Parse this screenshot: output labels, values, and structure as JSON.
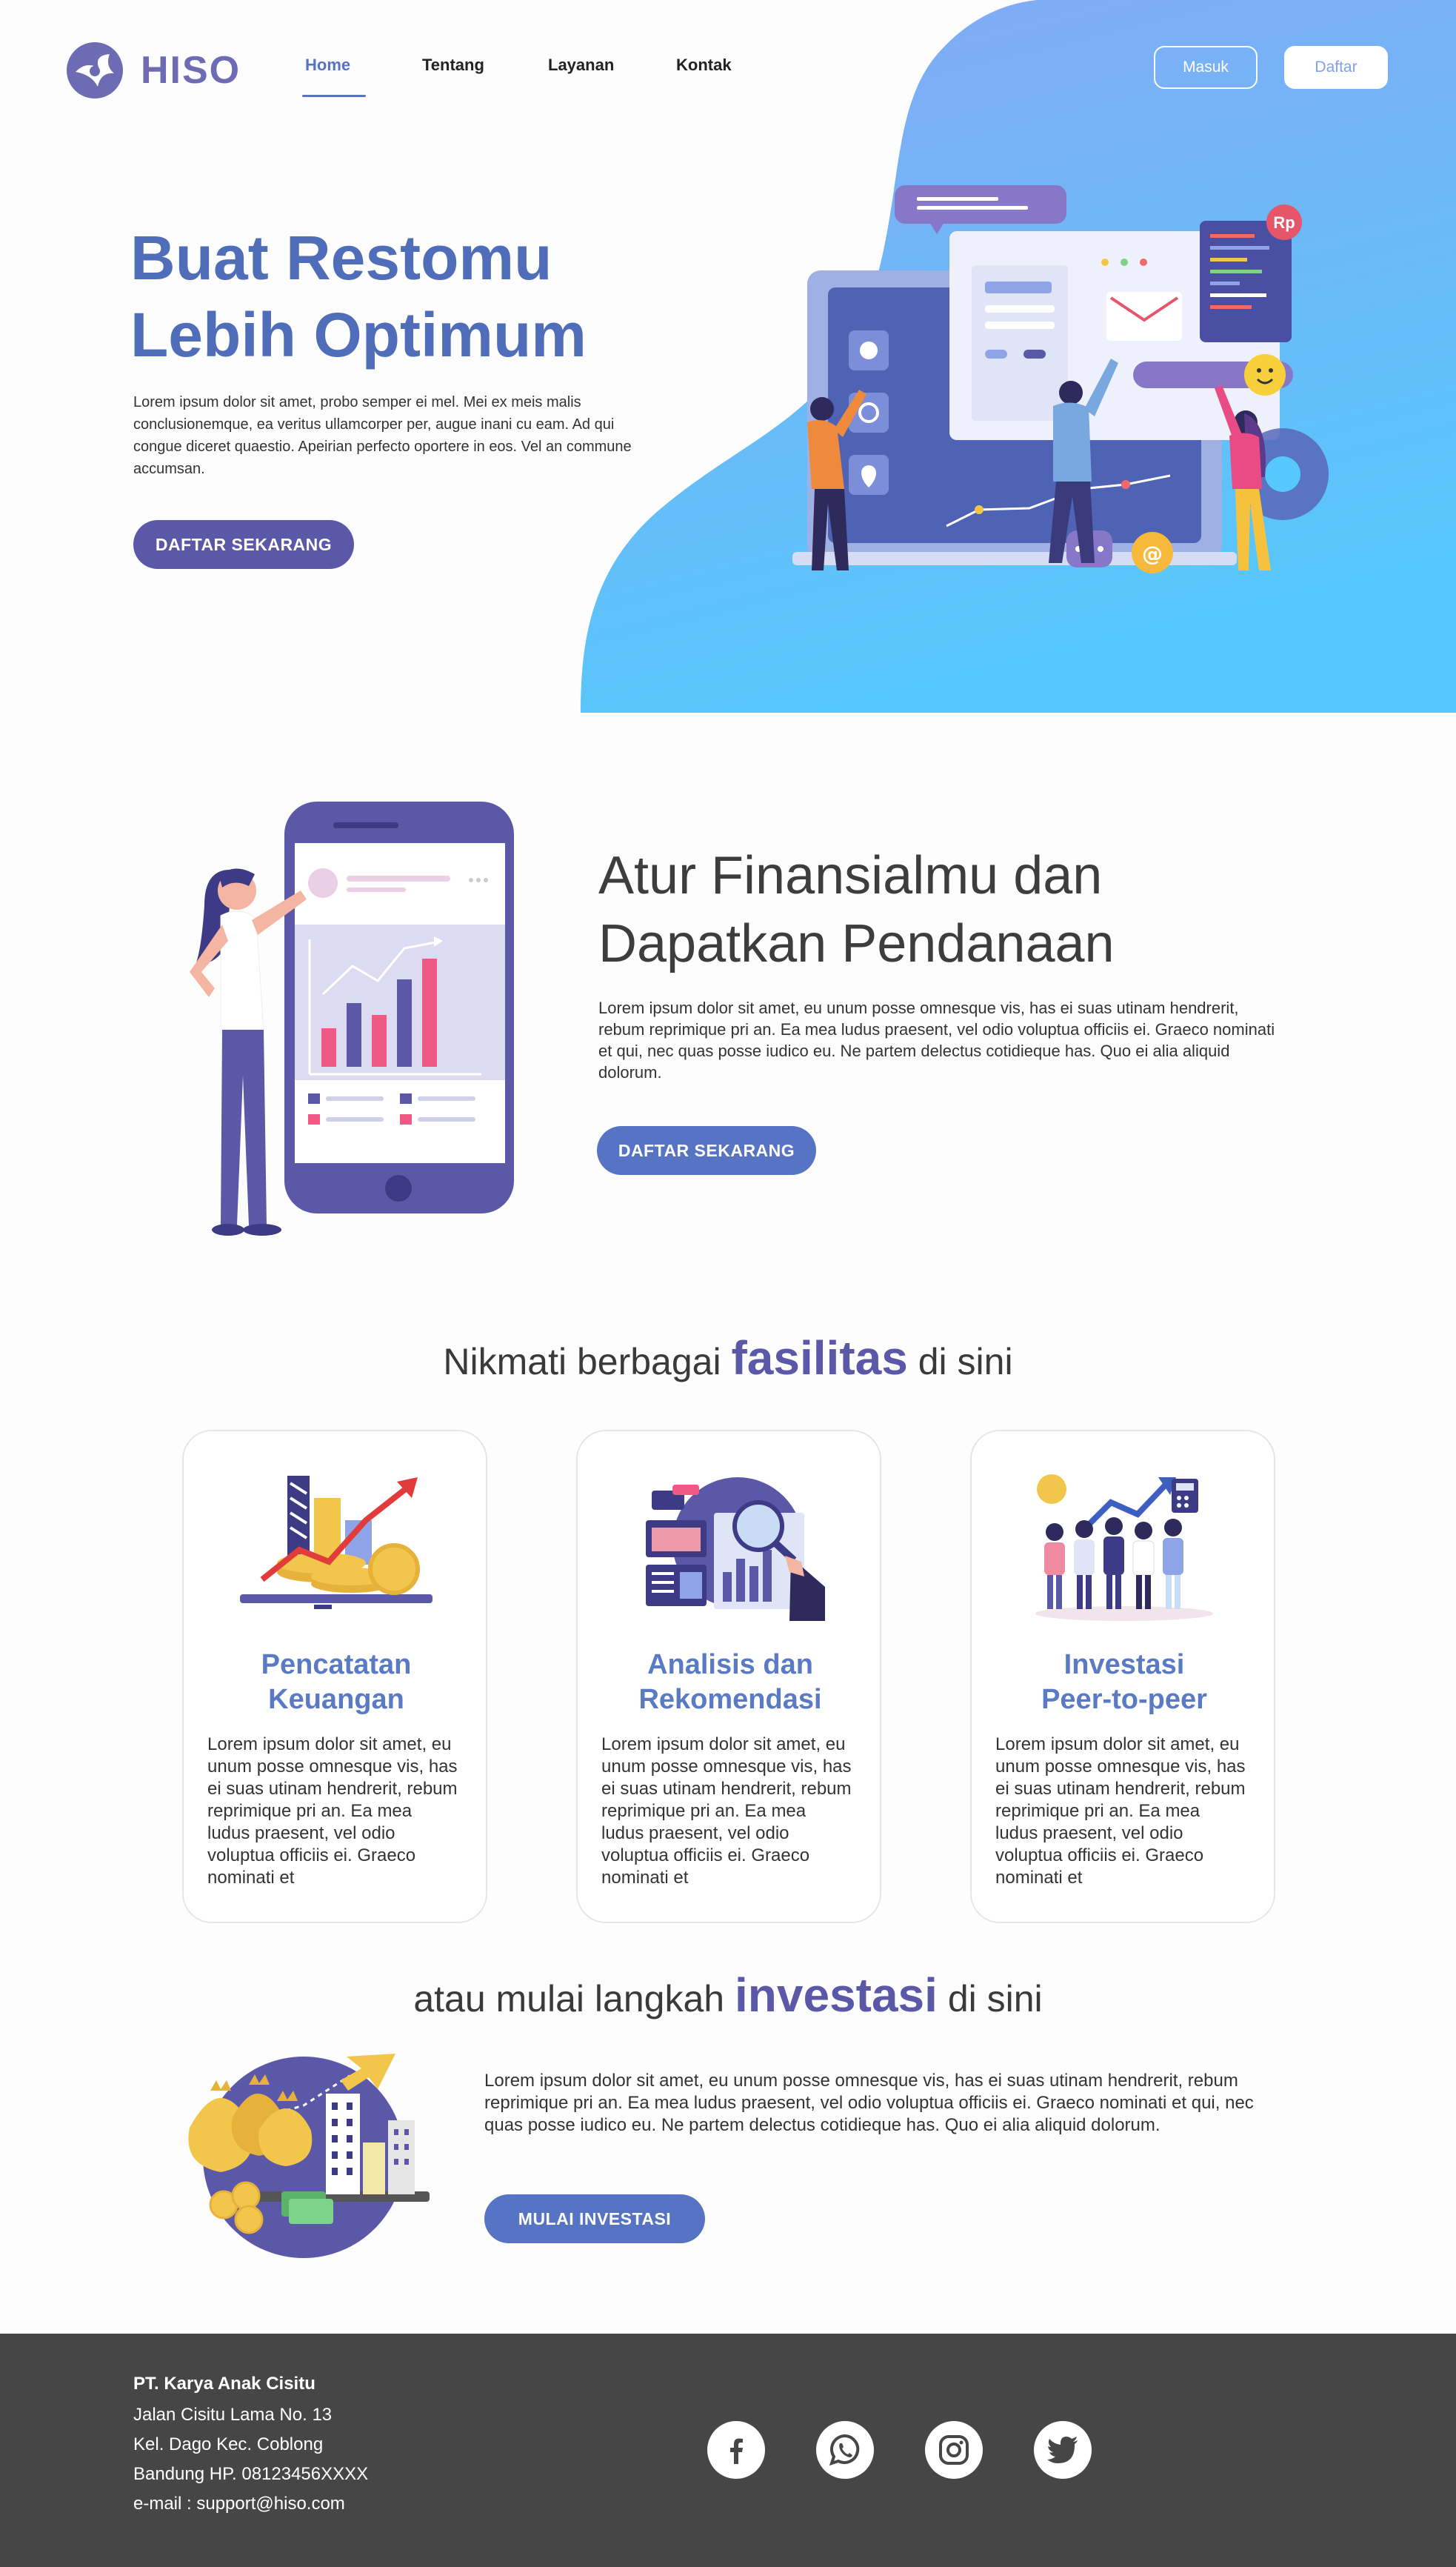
{
  "brand": {
    "name": "HISO",
    "accent": "#5b58a8",
    "blue": "#5673c4",
    "hero_gradient": [
      "#86a8f4",
      "#56c8fb"
    ]
  },
  "nav": {
    "links": [
      {
        "label": "Home",
        "active": true
      },
      {
        "label": "Tentang",
        "active": false
      },
      {
        "label": "Layanan",
        "active": false
      },
      {
        "label": "Kontak",
        "active": false
      }
    ],
    "login_label": "Masuk",
    "register_label": "Daftar"
  },
  "hero": {
    "title_line1": "Buat Restomu",
    "title_line2": "Lebih Optimum",
    "text": "Lorem ipsum dolor sit amet, probo semper ei mel. Mei ex meis malis conclusionemque, ea veritus ullamcorper per, augue inani cu eam. Ad qui congue diceret quaestio. Apeirian perfecto oportere in eos. Vel an commune accumsan.",
    "cta_label": "DAFTAR SEKARANG",
    "illustration_badge": "Rp"
  },
  "finance": {
    "title_line1": "Atur Finansialmu dan",
    "title_line2": "Dapatkan Pendanaan",
    "text": "Lorem ipsum dolor sit amet, eu unum posse omnesque vis, has ei suas utinam hendrerit, rebum reprimique pri an. Ea mea ludus praesent, vel odio voluptua officiis ei. Graeco nominati et qui, nec quas posse iudico eu. Ne partem delectus cotidieque has. Quo ei alia aliquid dolorum.",
    "cta_label": "DAFTAR SEKARANG"
  },
  "facilities": {
    "heading_pre": "Nikmati berbagai",
    "heading_em": "fasilitas",
    "heading_post": "di sini",
    "cards": [
      {
        "title_line1": "Pencatatan",
        "title_line2": "Keuangan",
        "icon": "finance-growth-icon",
        "text": "Lorem ipsum dolor sit amet, eu unum posse omnesque vis, has ei suas utinam hendrerit, rebum reprimique pri an. Ea mea ludus praesent, vel odio voluptua officiis ei. Graeco nominati et"
      },
      {
        "title_line1": "Analisis dan",
        "title_line2": "Rekomendasi",
        "icon": "analytics-icon",
        "text": "Lorem ipsum dolor sit amet, eu unum posse omnesque vis, has ei suas utinam hendrerit, rebum reprimique pri an. Ea mea ludus praesent, vel odio voluptua officiis ei. Graeco nominati et"
      },
      {
        "title_line1": "Investasi",
        "title_line2": "Peer-to-peer",
        "icon": "team-investment-icon",
        "text": "Lorem ipsum dolor sit amet, eu unum posse omnesque vis, has ei suas utinam hendrerit, rebum reprimique pri an. Ea mea ludus praesent, vel odio voluptua officiis ei. Graeco nominati et"
      }
    ]
  },
  "investment": {
    "heading_pre": "atau mulai langkah",
    "heading_em": "investasi",
    "heading_post": "di sini",
    "text": "Lorem ipsum dolor sit amet, eu unum posse omnesque vis, has ei suas utinam hendrerit, rebum reprimique pri an. Ea mea ludus praesent, vel odio voluptua officiis ei. Graeco nominati et qui, nec quas posse iudico eu. Ne partem delectus cotidieque has. Quo ei alia aliquid dolorum.",
    "cta_label": "MULAI INVESTASI"
  },
  "footer": {
    "company": "PT. Karya Anak Cisitu",
    "address_line1": "Jalan Cisitu Lama No. 13",
    "address_line2": "Kel. Dago Kec. Coblong",
    "address_line3": "Bandung HP. 08123456XXXX",
    "email_line": "e-mail : support@hiso.com",
    "social_icons": [
      "facebook-icon",
      "whatsapp-icon",
      "instagram-icon",
      "twitter-icon"
    ]
  }
}
